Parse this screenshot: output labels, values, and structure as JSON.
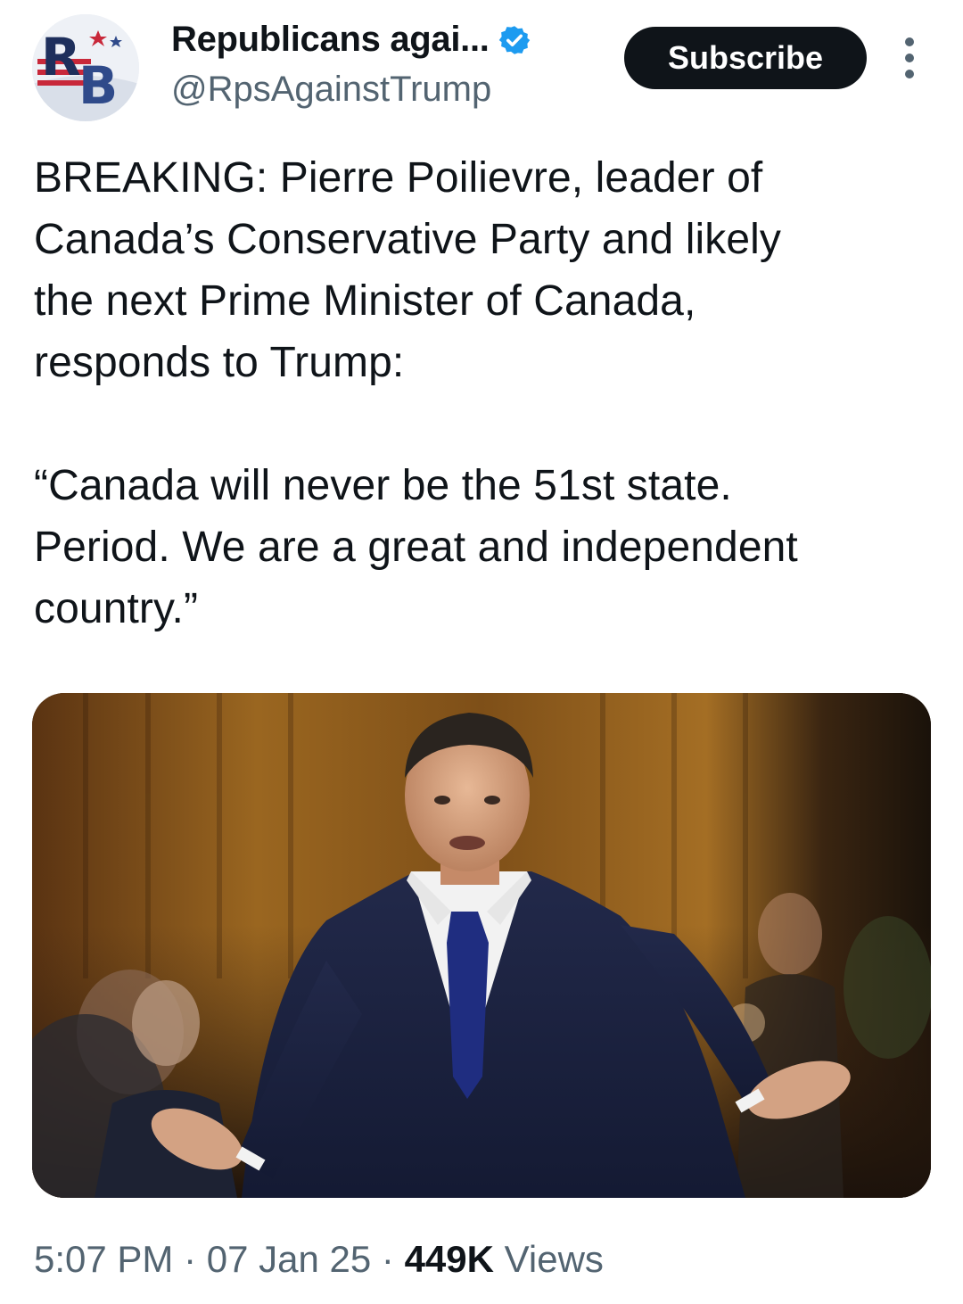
{
  "author": {
    "avatar_icon": "rb-logo-avatar",
    "display_name": "Republicans agai...",
    "verified_icon": "verified-badge-icon",
    "handle": "@RpsAgainstTrump"
  },
  "actions": {
    "subscribe_label": "Subscribe",
    "more_icon": "more-options-icon"
  },
  "tweet": {
    "text": "BREAKING: Pierre Poilievre, leader of\nCanada’s Conservative Party and likely\nthe next Prime Minister of Canada,\nresponds to Trump:\n\n“Canada will never be the 51st state.\nPeriod. We are a great and independent\ncountry.”",
    "media_description": "photo"
  },
  "meta": {
    "time": "5:07 PM",
    "separator": " · ",
    "date": "07 Jan 25",
    "views_count": "449K",
    "views_label": " Views"
  },
  "colors": {
    "text_primary": "#0f1419",
    "text_secondary": "#536471",
    "verified_blue": "#1d9bf0",
    "button_bg": "#0f1419"
  }
}
